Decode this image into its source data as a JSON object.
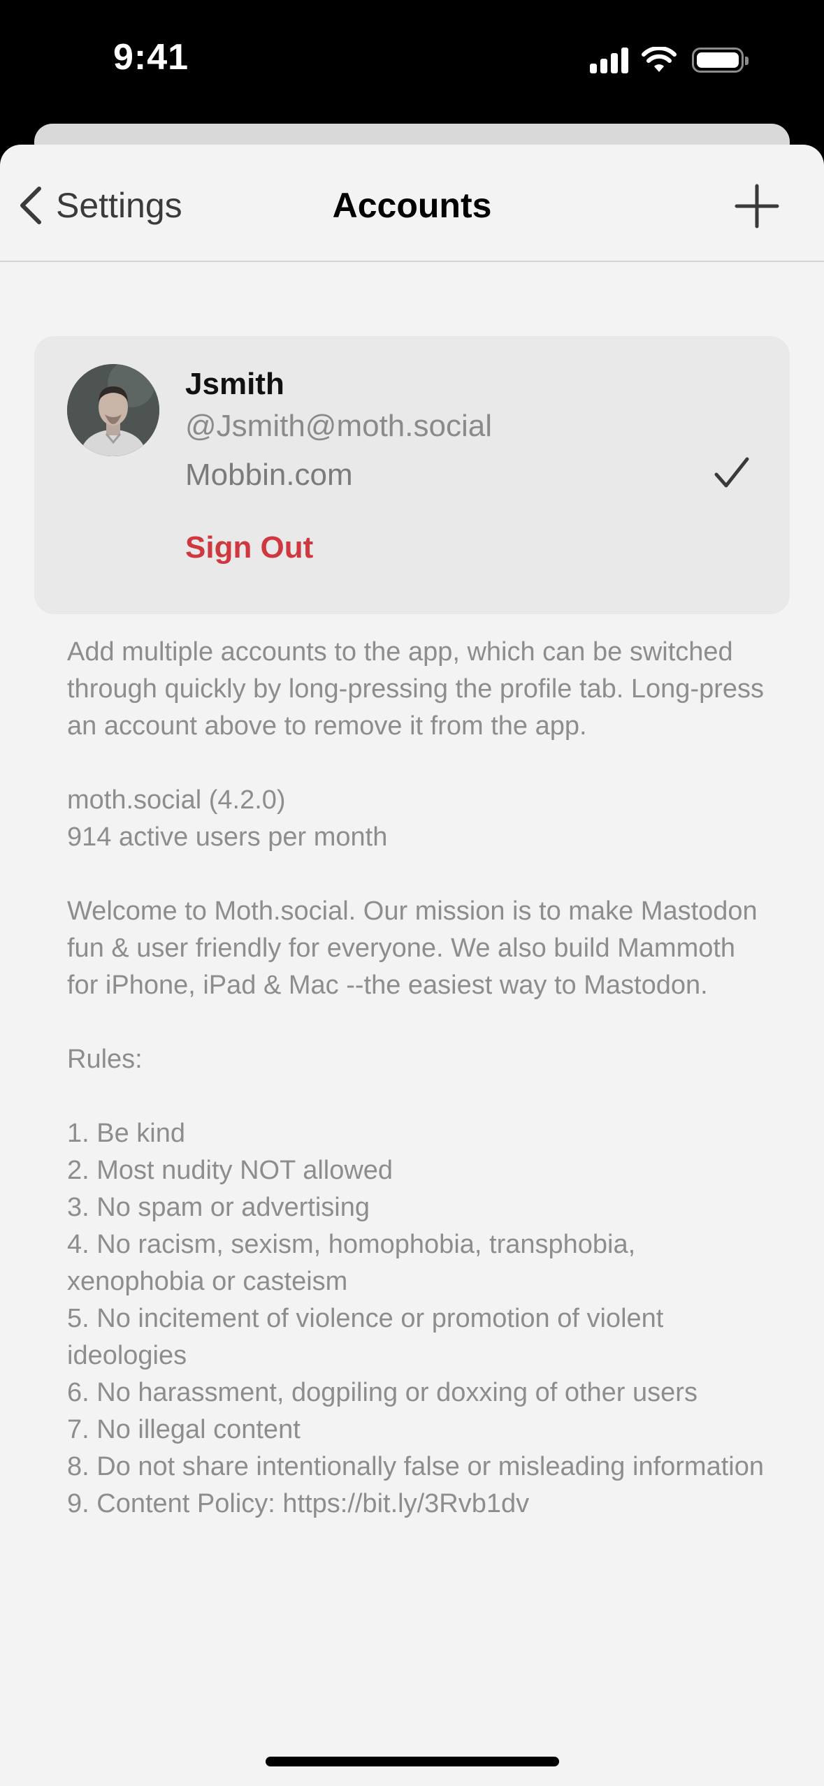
{
  "status_bar": {
    "time": "9:41"
  },
  "nav": {
    "back_label": "Settings",
    "title": "Accounts"
  },
  "account": {
    "name": "Jsmith",
    "handle": "@Jsmith@moth.social",
    "server": "Mobbin.com",
    "sign_out_label": "Sign Out",
    "selected": true
  },
  "info": {
    "intro": "Add multiple accounts to the app, which can be switched through quickly by long-pressing the profile tab. Long-press an account above to remove it from the app.",
    "instance_version": "moth.social (4.2.0)",
    "active_users": "914 active users per month",
    "welcome": "Welcome to Moth.social. Our mission is to make Mastodon fun & user friendly for everyone. We also build Mammoth for iPhone, iPad & Mac --the easiest way to Mastodon.",
    "rules_heading": "Rules:",
    "rules": [
      "1. Be kind",
      "2. Most nudity NOT allowed",
      "3. No spam or advertising",
      "4. No racism, sexism, homophobia, transphobia, xenophobia or casteism",
      "5. No incitement of violence or promotion of violent ideologies",
      "6. No harassment, dogpiling or doxxing of other users",
      "7. No illegal content",
      "8. Do not share intentionally false or misleading information",
      "9. Content Policy: https://bit.ly/3Rvb1dv"
    ]
  },
  "colors": {
    "accent_destructive": "#d0383f",
    "sheet_background": "#f3f3f3",
    "card_background": "#e9e9e9",
    "secondary_text": "#8d8d8d"
  },
  "icons": {
    "back": "chevron-left-icon",
    "add": "plus-icon",
    "selected": "checkmark-icon"
  }
}
